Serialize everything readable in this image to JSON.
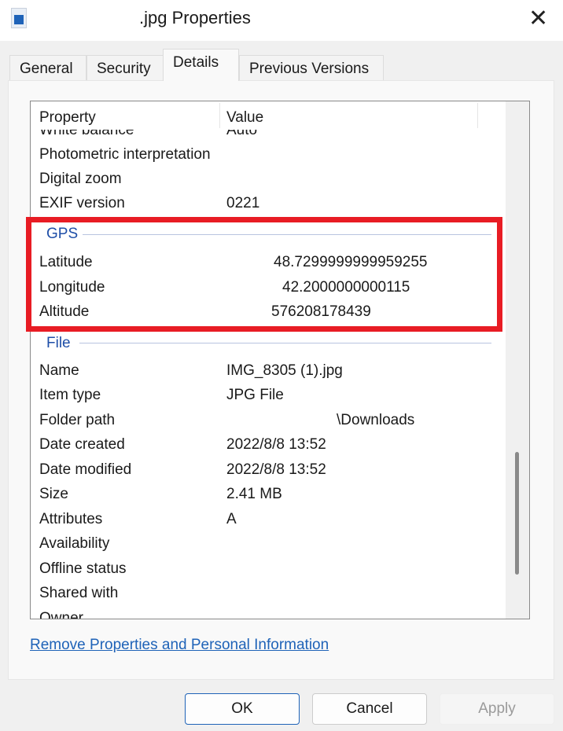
{
  "window": {
    "title": ".jpg Properties",
    "close_icon": "close-icon"
  },
  "tabs": [
    {
      "label": "General"
    },
    {
      "label": "Security"
    },
    {
      "label": "Details",
      "active": true
    },
    {
      "label": "Previous Versions"
    }
  ],
  "list": {
    "headers": {
      "property": "Property",
      "value": "Value"
    },
    "rows_top": [
      {
        "property": "White balance",
        "value": "Auto"
      },
      {
        "property": "Photometric interpretation",
        "value": ""
      },
      {
        "property": "Digital zoom",
        "value": ""
      },
      {
        "property": "EXIF version",
        "value": "0221"
      }
    ],
    "gps_group": "GPS",
    "gps_rows": [
      {
        "property": "Latitude",
        "value": "48.7299999999959255"
      },
      {
        "property": "Longitude",
        "value": "42.2000000000115"
      },
      {
        "property": "Altitude",
        "value": "576208178439"
      }
    ],
    "file_group": "File",
    "file_rows": [
      {
        "property": "Name",
        "value": "IMG_8305 (1).jpg"
      },
      {
        "property": "Item type",
        "value": "JPG File"
      },
      {
        "property": "Folder path",
        "value": "\\Downloads"
      },
      {
        "property": "Date created",
        "value": "2022/8/8 13:52"
      },
      {
        "property": "Date modified",
        "value": "2022/8/8 13:52"
      },
      {
        "property": "Size",
        "value": "2.41 MB"
      },
      {
        "property": "Attributes",
        "value": "A"
      },
      {
        "property": "Availability",
        "value": ""
      },
      {
        "property": "Offline status",
        "value": ""
      },
      {
        "property": "Shared with",
        "value": ""
      },
      {
        "property": "Owner",
        "value": ""
      }
    ]
  },
  "highlight_color": "#e81c24",
  "link": "Remove Properties and Personal Information",
  "buttons": {
    "ok": "OK",
    "cancel": "Cancel",
    "apply": "Apply"
  }
}
